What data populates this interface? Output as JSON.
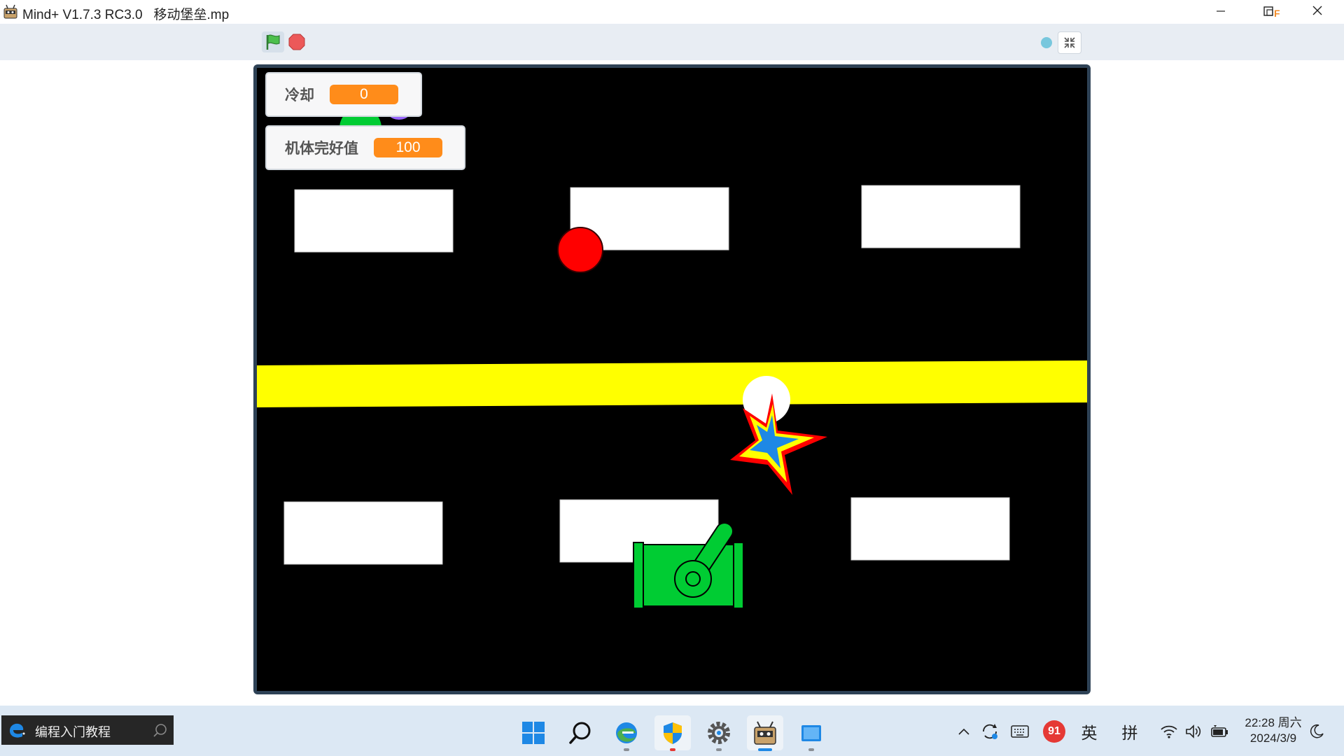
{
  "window": {
    "title": "Mind+ V1.7.3 RC3.0   移动堡垒.mp",
    "minimize_icon": "minimize-icon",
    "restore_icon": "restore-icon",
    "close_icon": "close-icon"
  },
  "toolbar": {
    "green_flag_icon": "green-flag-icon",
    "stop_icon": "stop-sign-icon",
    "fullscreen_icon": "exit-fullscreen-icon"
  },
  "stage": {
    "background_color": "#000000",
    "road_color": "#ffff00",
    "variables": [
      {
        "label": "冷却",
        "value": "0"
      },
      {
        "label": "机体完好值",
        "value": "100"
      }
    ],
    "sprites": {
      "tank_color": "#00cc33",
      "enemy_ball_color": "#ff0000",
      "explosion_colors": [
        "#ff0000",
        "#ffff00",
        "#1e88e5"
      ]
    }
  },
  "taskbar": {
    "search_text": "编程入门教程",
    "apps": [
      "windows-start-icon",
      "search-icon",
      "edge-browser-icon",
      "security-shield-icon",
      "settings-gear-icon",
      "mindplus-icon",
      "file-explorer-icon"
    ],
    "tray": {
      "notification_count": "91",
      "ime_lang": "英",
      "ime_mode": "拼",
      "time": "22:28 周六",
      "date": "2024/3/9"
    }
  }
}
